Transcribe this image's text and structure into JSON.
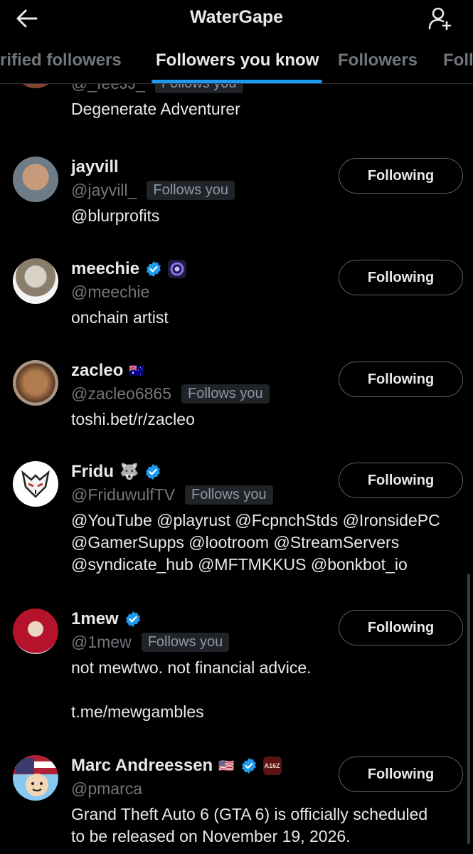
{
  "header": {
    "title": "WaterGape"
  },
  "tabs": [
    {
      "label": "Verified followers"
    },
    {
      "label": "Followers you know"
    },
    {
      "label": "Followers"
    },
    {
      "label": "Following"
    }
  ],
  "badge_text": "Follows you",
  "partial_top": {
    "handle": "@_feeJJ_",
    "badge": "Follows you",
    "bio": "Degenerate Adventurer"
  },
  "users": [
    {
      "name": "jayvill",
      "handle": "@jayvill_",
      "follows_you": "Follows you",
      "bio": "@blurprofits",
      "button": "Following",
      "verified": false,
      "emoji": ""
    },
    {
      "name": "meechie",
      "handle": "@meechie",
      "follows_you": "",
      "bio": "onchain artist",
      "button": "Following",
      "verified": true,
      "emoji": ""
    },
    {
      "name": "zacleo",
      "handle": "@zacleo6865",
      "follows_you": "Follows you",
      "bio": "toshi.bet/r/zacleo",
      "button": "Following",
      "verified": false,
      "emoji": "🇦🇺"
    },
    {
      "name": "Fridu",
      "handle": "@FriduwulfTV",
      "follows_you": "Follows you",
      "bio": "@YouTube @playrust @FcpnchStds @IronsidePC\n@GamerSupps @lootroom @StreamServers\n@syndicate_hub @MFTMKKUS @bonkbot_io",
      "button": "Following",
      "verified": true,
      "emoji": "🐺"
    },
    {
      "name": "1mew",
      "handle": "@1mew",
      "follows_you": "Follows you",
      "bio": "not mewtwo. not financial advice.\n\nt.me/mewgambles",
      "button": "Following",
      "verified": true,
      "emoji": ""
    },
    {
      "name": "Marc Andreessen",
      "handle": "@pmarca",
      "follows_you": "",
      "bio": "Grand Theft Auto 6 (GTA 6) is officially scheduled\nto be released on November 19, 2026.",
      "button": "Following",
      "verified": true,
      "emoji": "🇺🇸",
      "affiliate": "A16Z"
    }
  ],
  "colors": {
    "accent": "#1d9bf0",
    "muted": "#71767b",
    "text": "#e7e9ea",
    "badge_bg": "#202327"
  }
}
